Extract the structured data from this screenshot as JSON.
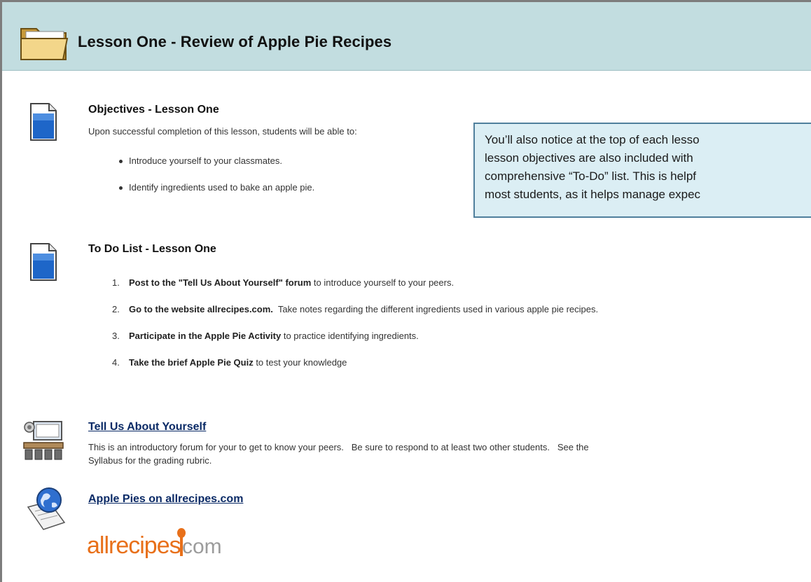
{
  "header": {
    "title": "Lesson One - Review of Apple Pie Recipes"
  },
  "objectives": {
    "title": "Objectives - Lesson One",
    "intro": "Upon successful completion of this lesson, students will be able to:",
    "items": [
      "Introduce yourself to your classmates.",
      "Identify ingredients used to bake an apple pie."
    ]
  },
  "callout": {
    "lines": [
      "You’ll also notice at the top of each lesso",
      "lesson objectives are also included with",
      "comprehensive “To-Do” list. This is helpf",
      "most students, as it helps manage expec"
    ]
  },
  "todo": {
    "title": "To Do List - Lesson One",
    "items": [
      {
        "num": "1.",
        "bold": "Post to the \"Tell Us About Yourself\" forum",
        "rest": " to introduce yourself to your peers."
      },
      {
        "num": "2.",
        "bold": "Go to the website allrecipes.com.",
        "rest": "  Take notes regarding the different ingredients used in various apple pie recipes."
      },
      {
        "num": "3.",
        "bold": "Participate in the Apple Pie Activity",
        "rest": " to practice identifying ingredients."
      },
      {
        "num": "4.",
        "bold": "Take the brief Apple Pie Quiz",
        "rest": " to test your knowledge"
      }
    ]
  },
  "forum": {
    "title": "Tell Us About Yourself",
    "description_line1": "This is an introductory forum for your to get to know your peers.   Be sure to respond to at least two other students.   See the",
    "description_line2": "Syllabus for the grading rubric."
  },
  "weblink": {
    "title": "Apple Pies on allrecipes.com"
  },
  "logo": {
    "main": "allrecipes",
    "suffix": "com"
  },
  "colors": {
    "header_bg": "#c2dde0",
    "callout_bg": "#dbeef4",
    "callout_border": "#4f7f9c",
    "link": "#0a2a66",
    "logo_orange": "#e8701a"
  },
  "icons": [
    "folder-icon",
    "document-icon",
    "document-icon",
    "discussion-forum-icon",
    "web-link-icon"
  ]
}
